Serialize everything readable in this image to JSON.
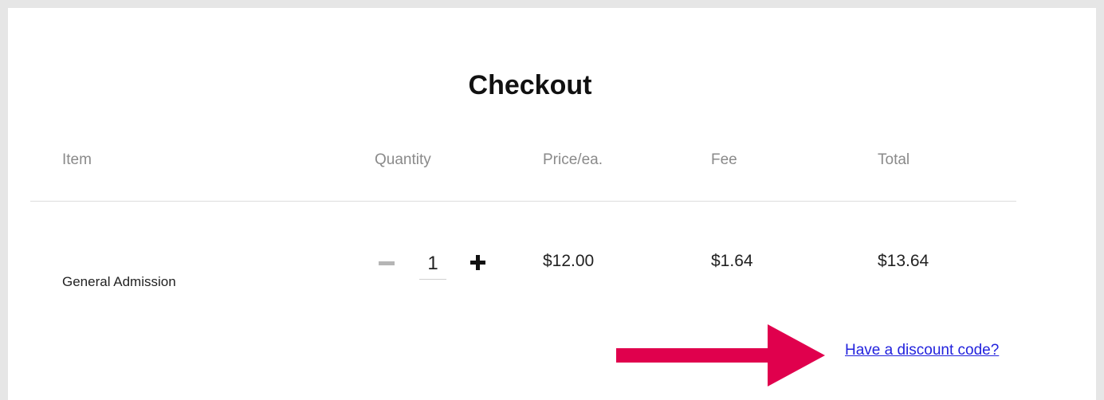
{
  "checkout": {
    "title": "Checkout",
    "columns": {
      "item": "Item",
      "quantity": "Quantity",
      "price": "Price/ea.",
      "fee": "Fee",
      "total": "Total"
    },
    "row": {
      "item": "General Admission",
      "quantity": "1",
      "price": "$12.00",
      "fee": "$1.64",
      "total": "$13.64"
    },
    "discount_link": "Have a discount code?"
  },
  "colors": {
    "link": "#2222dd",
    "annotation_arrow": "#e0004d",
    "minus_icon": "#b5b5b5"
  },
  "icons": {
    "decrement": "minus-icon",
    "increment": "plus-icon",
    "annotation": "arrow-right-icon"
  }
}
